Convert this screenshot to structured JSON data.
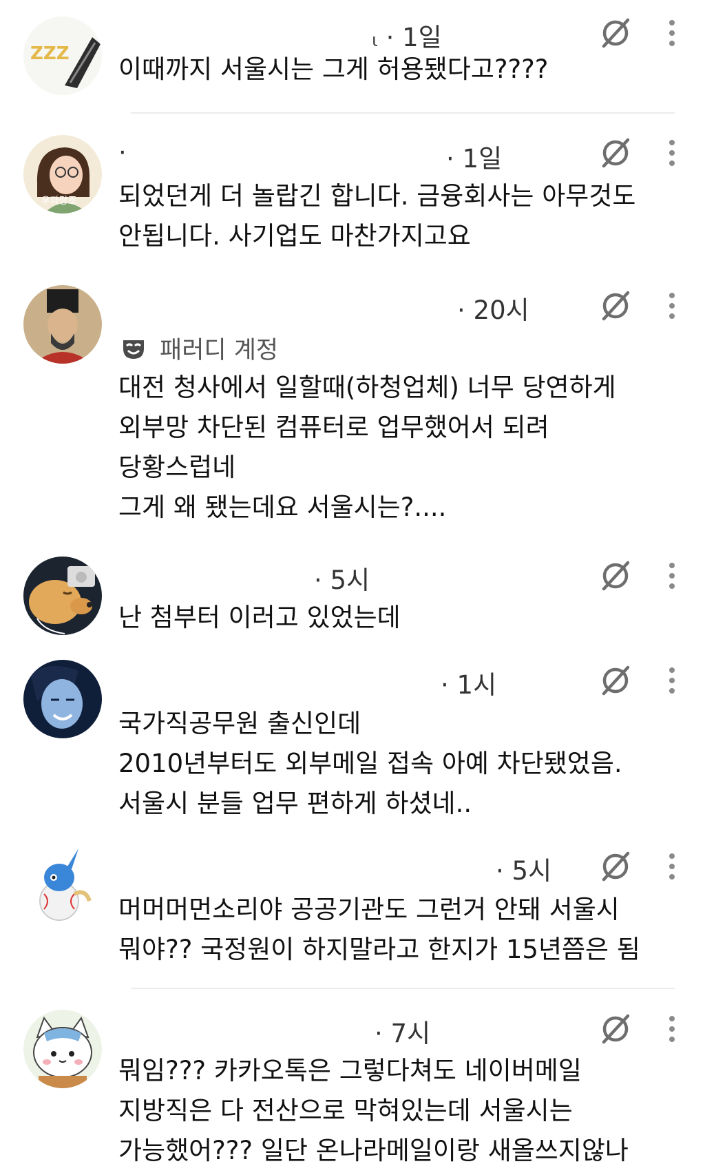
{
  "posts": [
    {
      "author": "ι",
      "time": "· 1일",
      "text": "이때까지 서울시는 그게 허용됐다고????"
    },
    {
      "author": "·",
      "time": "· 1일",
      "text": "되었던게 더 놀랍긴 합니다. 금융회사는 아무것도\n안됩니다. 사기업도 마찬가지고요"
    },
    {
      "author": "",
      "time": "· 20시",
      "badge": "패러디 계정",
      "text": "대전 청사에서 일할때(하청업체) 너무 당연하게\n외부망 차단된 컴퓨터로 업무했어서 되려\n당황스럽네\n그게 왜 됐는데요 서울시는?...."
    },
    {
      "author": "",
      "time": "· 5시",
      "text": "난 첨부터 이러고 있었는데"
    },
    {
      "author": "",
      "time": "· 1시",
      "text": "국가직공무원 출신인데\n2010년부터도 외부메일 접속 아예 차단됐었음.\n서울시 분들 업무 편하게 하셨네.."
    },
    {
      "author": "",
      "time": "· 5시",
      "text": "머머머먼소리야 공공기관도 그런거 안돼 서울시\n뭐야?? 국정원이 하지말라고 한지가 15년쯤은 됨"
    },
    {
      "author": "",
      "time": "· 7시",
      "text": "뭐임??? 카카오톡은 그렇다쳐도 네이버메일\n지방직은 다 전산으로 막혀있는데 서울시는\n가능했어??? 일단 온나라메일이랑 새올쓰지않나"
    }
  ],
  "avatar_texts": {
    "zzz": "ZZZ",
    "name_tag": "우파랑조"
  },
  "icons": {
    "mute": "mute-icon",
    "more": "more-options-icon",
    "parody": "parody-mask-icon"
  },
  "colors": {
    "text": "#111111",
    "meta": "#333333",
    "icon": "#6e6e6e",
    "divider": "#ececec"
  }
}
